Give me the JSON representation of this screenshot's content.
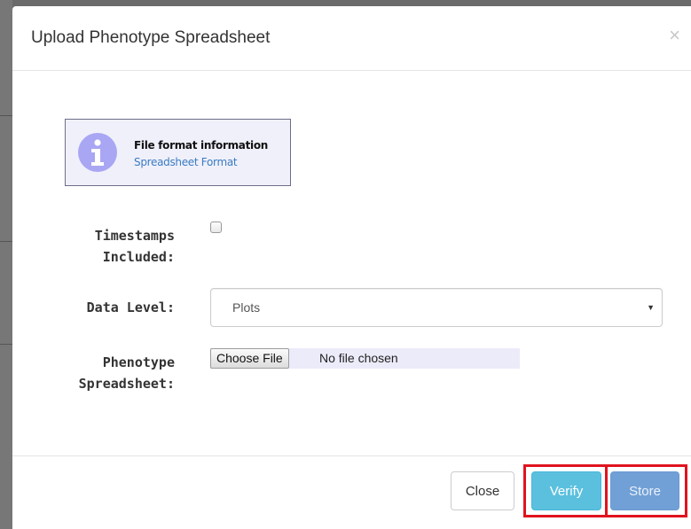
{
  "modal": {
    "title": "Upload Phenotype Spreadsheet",
    "close_symbol": "×"
  },
  "info": {
    "icon": "info-icon",
    "title": "File format information",
    "link": "Spreadsheet Format"
  },
  "form": {
    "timestamps_label_line1": "Timestamps",
    "timestamps_label_line2": "Included:",
    "timestamps_checked": false,
    "data_level_label": "Data Level:",
    "data_level_value": "Plots",
    "spreadsheet_label_line1": "Phenotype",
    "spreadsheet_label_line2": "Spreadsheet:",
    "choose_file": "Choose File",
    "no_file": "No file chosen"
  },
  "footer": {
    "close": "Close",
    "verify": "Verify",
    "store": "Store"
  },
  "colors": {
    "highlight": "#e0131f",
    "verify": "#5bc0de",
    "store": "#71a0d6",
    "info_icon": "#a9a6f3"
  }
}
